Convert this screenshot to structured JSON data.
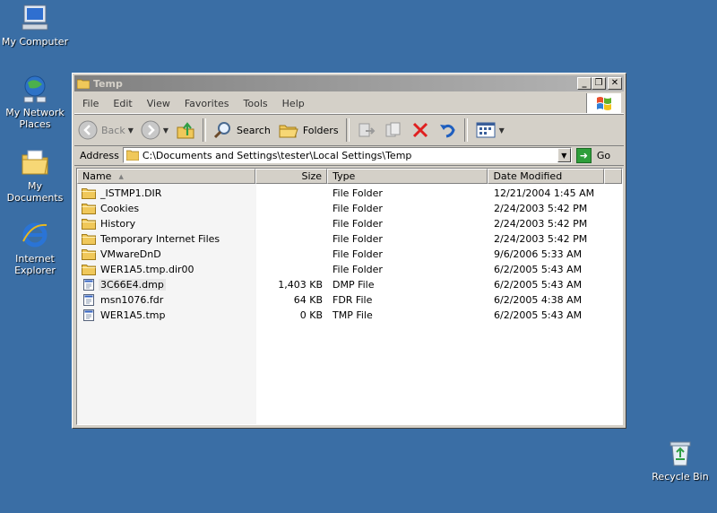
{
  "desktop": {
    "icons": [
      {
        "label": "My Computer"
      },
      {
        "label": "My Network Places"
      },
      {
        "label": "My Documents"
      },
      {
        "label": "Internet Explorer"
      },
      {
        "label": "Recycle Bin"
      }
    ]
  },
  "window": {
    "title": "Temp",
    "controls": {
      "minimize": "_",
      "restore": "❐",
      "close": "✕"
    },
    "menu": [
      "File",
      "Edit",
      "View",
      "Favorites",
      "Tools",
      "Help"
    ],
    "toolbar": {
      "back": "Back",
      "search": "Search",
      "folders": "Folders"
    },
    "address": {
      "label": "Address",
      "value": "C:\\Documents and Settings\\tester\\Local Settings\\Temp",
      "go": "Go"
    },
    "columns": {
      "name": "Name",
      "size": "Size",
      "type": "Type",
      "date": "Date Modified"
    },
    "files": [
      {
        "name": "_ISTMP1.DIR",
        "size": "",
        "type": "File Folder",
        "date": "12/21/2004 1:45 AM",
        "kind": "folder"
      },
      {
        "name": "Cookies",
        "size": "",
        "type": "File Folder",
        "date": "2/24/2003 5:42 PM",
        "kind": "folder"
      },
      {
        "name": "History",
        "size": "",
        "type": "File Folder",
        "date": "2/24/2003 5:42 PM",
        "kind": "folder"
      },
      {
        "name": "Temporary Internet Files",
        "size": "",
        "type": "File Folder",
        "date": "2/24/2003 5:42 PM",
        "kind": "folder"
      },
      {
        "name": "VMwareDnD",
        "size": "",
        "type": "File Folder",
        "date": "9/6/2006 5:33 AM",
        "kind": "folder"
      },
      {
        "name": "WER1A5.tmp.dir00",
        "size": "",
        "type": "File Folder",
        "date": "6/2/2005 5:43 AM",
        "kind": "folder"
      },
      {
        "name": "3C66E4.dmp",
        "size": "1,403 KB",
        "type": "DMP File",
        "date": "6/2/2005 5:43 AM",
        "kind": "file",
        "selected": true
      },
      {
        "name": "msn1076.fdr",
        "size": "64 KB",
        "type": "FDR File",
        "date": "6/2/2005 4:38 AM",
        "kind": "file"
      },
      {
        "name": "WER1A5.tmp",
        "size": "0 KB",
        "type": "TMP File",
        "date": "6/2/2005 5:43 AM",
        "kind": "file"
      }
    ]
  }
}
